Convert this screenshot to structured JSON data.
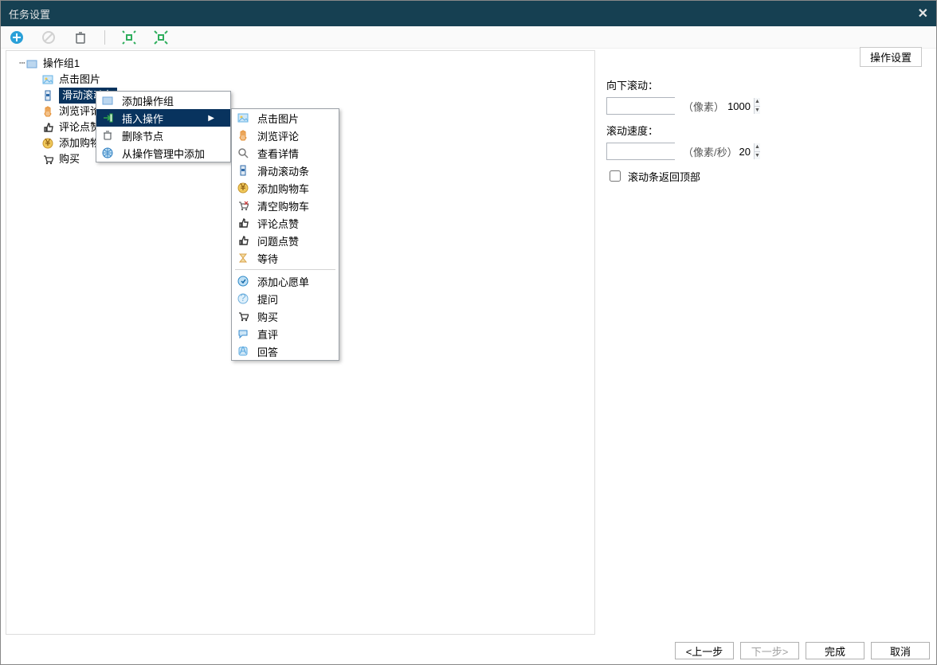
{
  "window": {
    "title": "任务设置"
  },
  "toolbar": {
    "add_icon": "add",
    "disable_icon": "forbidden",
    "delete_icon": "trash",
    "expand_icon": "expand",
    "collapse_icon": "collapse"
  },
  "tree": {
    "root": {
      "label": "操作组1",
      "icon": "group"
    },
    "children": [
      {
        "label": "点击图片",
        "icon": "image",
        "selected": false
      },
      {
        "label": "滑动滚动条",
        "icon": "scroll",
        "selected": true
      },
      {
        "label": "浏览评论",
        "icon": "hand",
        "selected": false
      },
      {
        "label": "评论点赞",
        "icon": "thumb",
        "selected": false
      },
      {
        "label": "添加购物车",
        "icon": "coin",
        "selected": false
      },
      {
        "label": "购买",
        "icon": "cart",
        "selected": false
      }
    ]
  },
  "context_menu": {
    "items": [
      {
        "label": "添加操作组",
        "icon": "group",
        "hl": false
      },
      {
        "label": "插入操作",
        "icon": "insert",
        "hl": true,
        "submenu": true
      },
      {
        "label": "删除节点",
        "icon": "trash",
        "hl": false
      },
      {
        "label": "从操作管理中添加",
        "icon": "globe",
        "hl": false
      }
    ],
    "submenu": [
      {
        "label": "点击图片",
        "icon": "image"
      },
      {
        "label": "浏览评论",
        "icon": "hand"
      },
      {
        "label": "查看详情",
        "icon": "search"
      },
      {
        "label": "滑动滚动条",
        "icon": "scroll"
      },
      {
        "label": "添加购物车",
        "icon": "coin"
      },
      {
        "label": "清空购物车",
        "icon": "cartx"
      },
      {
        "label": "评论点赞",
        "icon": "thumb"
      },
      {
        "label": "问题点赞",
        "icon": "thumb"
      },
      {
        "label": "等待",
        "icon": "hourglass"
      },
      {
        "sep": true
      },
      {
        "label": "添加心愿单",
        "icon": "wish"
      },
      {
        "label": "提问",
        "icon": "question"
      },
      {
        "label": "购买",
        "icon": "cart"
      },
      {
        "label": "直评",
        "icon": "bubble"
      },
      {
        "label": "回答",
        "icon": "answer"
      }
    ]
  },
  "panel": {
    "tab": "操作设置",
    "scroll_down_label": "向下滚动：",
    "scroll_down_value": "1000",
    "scroll_down_unit": "（像素）",
    "speed_label": "滚动速度：",
    "speed_value": "20",
    "speed_unit": "（像素/秒）",
    "return_top_label": "滚动条返回顶部",
    "return_top_checked": false
  },
  "footer": {
    "prev": "<上一步",
    "next": "下一步>",
    "finish": "完成",
    "cancel": "取消"
  },
  "icons": {
    "colors": {
      "add": "#2aa0d8",
      "trash": "#6b6f73",
      "group": "#6fa4d8",
      "image": "#64b3e6",
      "scroll": "#2f6aa8",
      "hand": "#e38b2b",
      "thumb": "#333",
      "coin": "#e6a53b",
      "cart": "#333",
      "cartx": "#666",
      "globe": "#2b7bbf",
      "insert": "#2fa54a",
      "search": "#7a7a7a",
      "hourglass": "#d9a24a",
      "wish": "#2b88c8",
      "question": "#6fb0de",
      "bubble": "#3a8ccf",
      "answer": "#5aa9e0",
      "expand": "#2fae5d",
      "collapse": "#2fae5d"
    }
  }
}
